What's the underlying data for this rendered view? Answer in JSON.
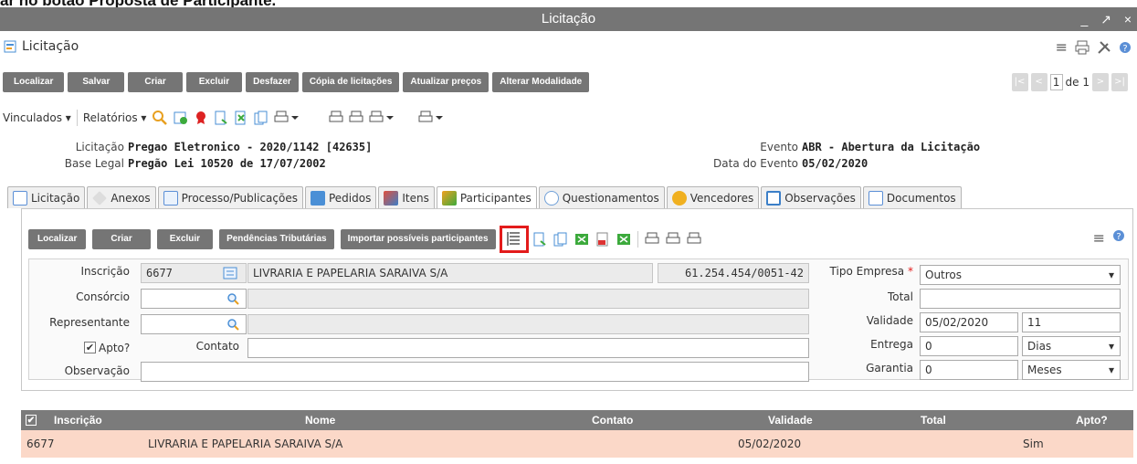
{
  "caption": "ar no botão Proposta de Participante.",
  "window": {
    "title": "Licitação",
    "controls": [
      "_",
      "↗",
      "×"
    ]
  },
  "header": {
    "title": "Licitação"
  },
  "toolbar": {
    "buttons": [
      "Localizar",
      "Salvar",
      "Criar",
      "Excluir",
      "Desfazer",
      "Cópia de licitações",
      "Atualizar preços",
      "Alterar Modalidade"
    ]
  },
  "pager": {
    "current": "1",
    "of_label": "de 1"
  },
  "toolbar2": {
    "vinculados": "Vinculados ▾",
    "relatorios": "Relatórios ▾"
  },
  "info": {
    "licitacao_label": "Licitação",
    "licitacao_value": "Pregao Eletronico - 2020/1142 [42635]",
    "base_legal_label": "Base Legal",
    "base_legal_value": "Pregão Lei 10520 de 17/07/2002",
    "evento_label": "Evento",
    "evento_value": "ABR - Abertura da Licitação",
    "data_evento_label": "Data do Evento",
    "data_evento_value": "05/02/2020"
  },
  "tabs": [
    {
      "label": "Licitação",
      "icon": "document-icon",
      "color": "#5b8fd6"
    },
    {
      "label": "Anexos",
      "icon": "paperclip-icon",
      "color": "#999999"
    },
    {
      "label": "Processo/Publicações",
      "icon": "documents-icon",
      "color": "#5b8fd6"
    },
    {
      "label": "Pedidos",
      "icon": "form-icon",
      "color": "#4a8fd6"
    },
    {
      "label": "Itens",
      "icon": "colors-icon",
      "color": "#e04f3c"
    },
    {
      "label": "Participantes",
      "icon": "users-icon",
      "color": "#f0a020"
    },
    {
      "label": "Questionamentos",
      "icon": "chat-icon",
      "color": "#6fa0d8"
    },
    {
      "label": "Vencedores",
      "icon": "medal-icon",
      "color": "#f0b020"
    },
    {
      "label": "Observações",
      "icon": "window-icon",
      "color": "#3c7fc8"
    },
    {
      "label": "Documentos",
      "icon": "document-icon",
      "color": "#5b8fd6"
    }
  ],
  "panel_toolbar": {
    "buttons": [
      "Localizar",
      "Criar",
      "Excluir",
      "Pendências Tributárias",
      "Importar possíveis participantes"
    ]
  },
  "form": {
    "inscricao_label": "Inscrição",
    "inscricao_value": "6677",
    "nome_value": "LIVRARIA E PAPELARIA SARAIVA S/A",
    "cnpj_value": "61.254.454/0051-42",
    "consorcio_label": "Consórcio",
    "representante_label": "Representante",
    "apto_label": "Apto?",
    "contato_label": "Contato",
    "observacao_label": "Observação",
    "tipo_empresa_label": "Tipo Empresa",
    "required_mark": "*",
    "tipo_empresa_value": "Outros",
    "total_label": "Total",
    "validade_label": "Validade",
    "validade_date": "05/02/2020",
    "validade_days": "11",
    "entrega_label": "Entrega",
    "entrega_value": "0",
    "entrega_unit": "Dias",
    "garantia_label": "Garantia",
    "garantia_value": "0",
    "garantia_unit": "Meses"
  },
  "grid": {
    "columns": [
      "Inscrição",
      "Nome",
      "Contato",
      "Validade",
      "Total",
      "Apto?"
    ],
    "rows": [
      {
        "inscricao": "6677",
        "nome": "LIVRARIA E PAPELARIA SARAIVA S/A",
        "contato": "",
        "validade": "05/02/2020",
        "total": "",
        "apto": "Sim"
      }
    ]
  },
  "colors": {
    "button_gray": "#757575",
    "row_highlight": "#fbd8c8",
    "focus_outline": "#e31b1b"
  }
}
